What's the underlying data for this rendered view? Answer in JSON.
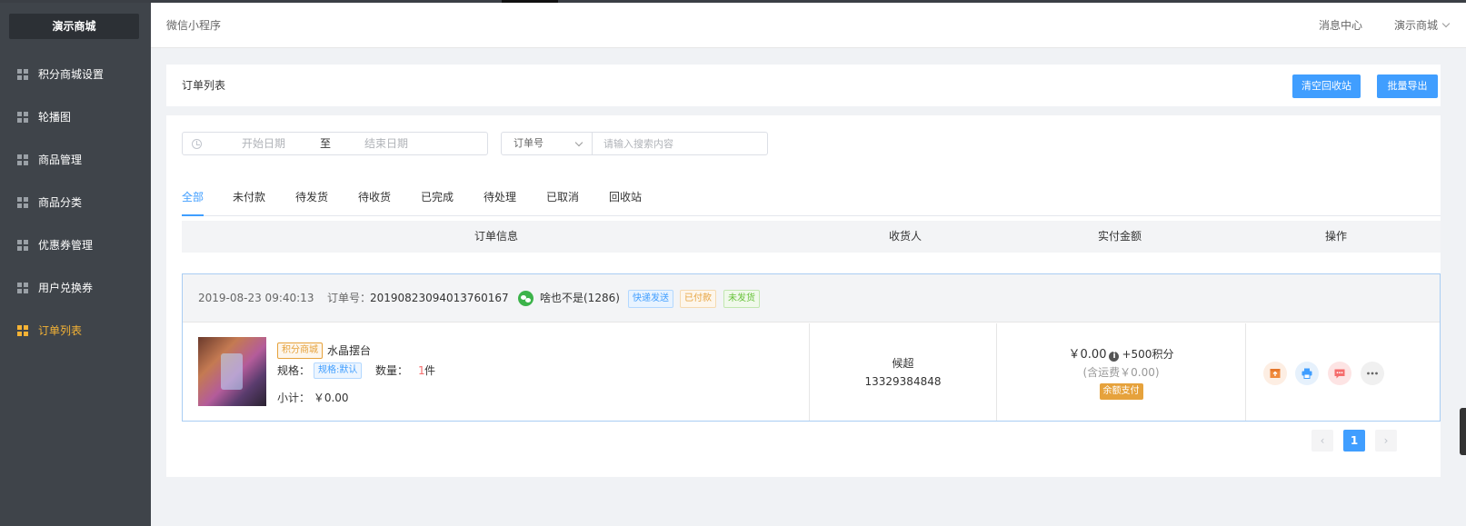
{
  "sidebar": {
    "brand": "演示商城",
    "items": [
      {
        "label": "积分商城设置"
      },
      {
        "label": "轮播图"
      },
      {
        "label": "商品管理"
      },
      {
        "label": "商品分类"
      },
      {
        "label": "优惠券管理"
      },
      {
        "label": "用户兑换券"
      },
      {
        "label": "订单列表"
      }
    ],
    "active_index": 6
  },
  "header": {
    "title": "微信小程序",
    "message_center": "消息中心",
    "shop": "演示商城"
  },
  "page": {
    "title": "订单列表",
    "btn_clear_recycle": "清空回收站",
    "btn_export": "批量导出"
  },
  "filter": {
    "start_placeholder": "开始日期",
    "range_sep": "至",
    "end_placeholder": "结束日期",
    "select_value": "订单号",
    "search_placeholder": "请输入搜索内容"
  },
  "tabs": [
    "全部",
    "未付款",
    "待发货",
    "待收货",
    "已完成",
    "待处理",
    "已取消",
    "回收站"
  ],
  "table": {
    "headers": [
      "订单信息",
      "收货人",
      "实付金额",
      "操作"
    ]
  },
  "order": {
    "time": "2019-08-23 09:40:13",
    "order_no_label": "订单号：",
    "order_no": "20190823094013760167",
    "user": "啥也不是(1286)",
    "tags": [
      "快递发送",
      "已付款",
      "未发货"
    ],
    "shop_tag": "积分商城",
    "product_name": "水晶摆台",
    "spec_label": "规格：",
    "spec_value": "规格:默认",
    "qty_label": "数量：",
    "qty_value": "1",
    "qty_unit": "件",
    "subtotal": "小计： ￥0.00",
    "receiver_name": "候超",
    "receiver_phone": "13329384848",
    "amount": "￥0.00",
    "points": "+500积分",
    "shipping": "(含运费￥0.00)",
    "pay_method": "余额支付"
  },
  "pagination": {
    "current": "1",
    "prev_glyph": "‹",
    "next_glyph": "›"
  },
  "colors": {
    "sidebar_bg": "#3f444a",
    "accent": "#409eff",
    "active_menu": "#f5b335"
  }
}
